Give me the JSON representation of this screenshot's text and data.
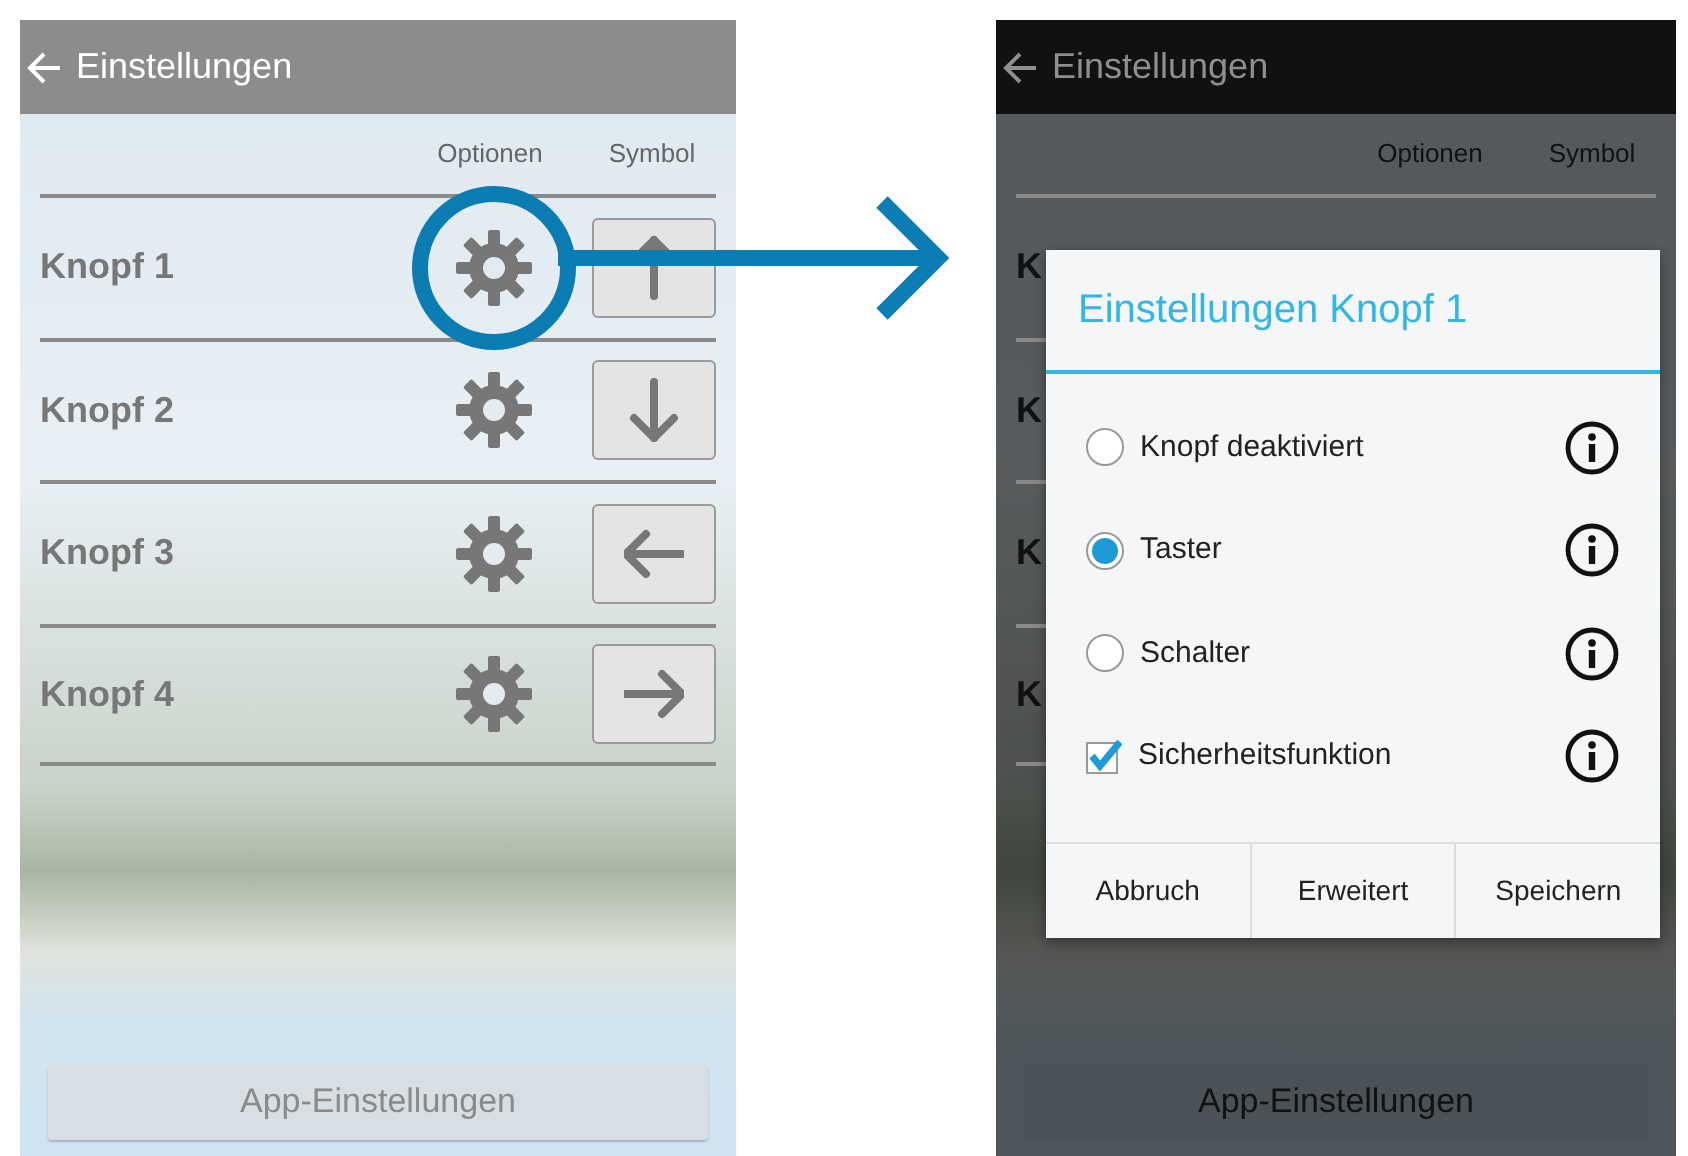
{
  "screens": [
    {
      "kind": "list",
      "title": "Einstellungen",
      "dimmed": false,
      "columns": [
        "Optionen",
        "Symbol"
      ],
      "rows": [
        {
          "label": "Knopf 1",
          "kind": "up",
          "highlighted": true
        },
        {
          "label": "Knopf 2",
          "kind": "down",
          "highlighted": false
        },
        {
          "label": "Knopf 3",
          "kind": "left",
          "highlighted": false
        },
        {
          "label": "Knopf 4",
          "kind": "right",
          "highlighted": false
        }
      ],
      "footer_button": "App-Einstellungen"
    },
    {
      "kind": "dialog",
      "title": "Einstellungen",
      "dimmed": true,
      "columns": [
        "Optionen",
        "Symbol"
      ],
      "rows": [
        {
          "label": "K"
        },
        {
          "label": "K"
        },
        {
          "label": "K"
        },
        {
          "label": "K"
        }
      ],
      "footer_button": "App-Einstellungen",
      "dialog": {
        "title": "Einstellungen Knopf 1",
        "options": [
          {
            "kind": "radio",
            "label": "Knopf deaktiviert",
            "selected": false
          },
          {
            "kind": "radio",
            "label": "Taster",
            "selected": true
          },
          {
            "kind": "radio",
            "label": "Schalter",
            "selected": false
          },
          {
            "kind": "checkbox",
            "label": "Sicherheitsfunktion",
            "checked": true
          }
        ],
        "buttons": [
          "Abbruch",
          "Erweitert",
          "Speichern"
        ]
      }
    }
  ]
}
